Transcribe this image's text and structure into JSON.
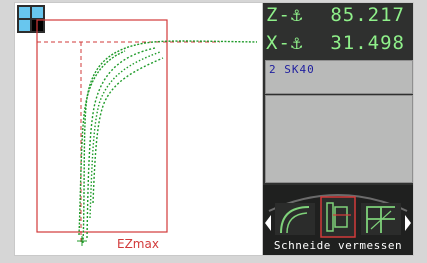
{
  "plot": {
    "limit_label": "EZmax"
  },
  "readouts": {
    "z": {
      "label": "Z-⚓",
      "value": "85.217"
    },
    "x": {
      "label": "X-⚓",
      "value": "31.498"
    }
  },
  "tool": {
    "name": "2 SK40"
  },
  "menu": {
    "caption": "Schneide vermessen"
  },
  "colors": {
    "limit_box": "#d23a3a",
    "curve": "#1f9b2a",
    "readout_text": "#8ff08a",
    "side_panel": "#2f302f"
  }
}
